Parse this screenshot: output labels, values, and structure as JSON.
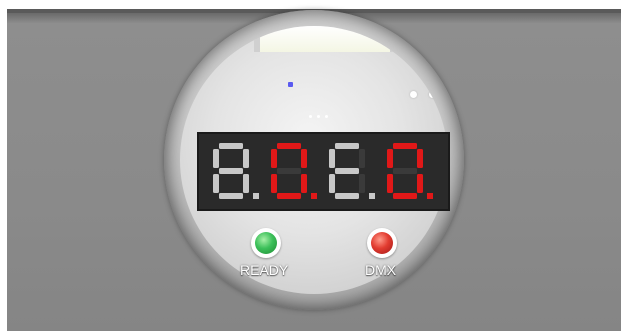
{
  "device": {
    "display": {
      "digits": [
        {
          "glyph": "8",
          "color": "#c8c8c8",
          "dp": true
        },
        {
          "glyph": "-",
          "color": "#e01818",
          "dp": true
        },
        {
          "glyph": "E",
          "color": "#c8c8c8",
          "dp": true
        },
        {
          "glyph": "-",
          "color": "#e01818",
          "dp": true
        }
      ],
      "lit_segment_color": "#e01818",
      "unlit_segment_color": "#c8c8c8"
    },
    "indicators": {
      "ready": {
        "label": "READY",
        "color": "#3cc05a"
      },
      "dmx": {
        "label": "DMX",
        "color": "#e23c30"
      }
    },
    "status_led_color": "#5a5af0"
  }
}
